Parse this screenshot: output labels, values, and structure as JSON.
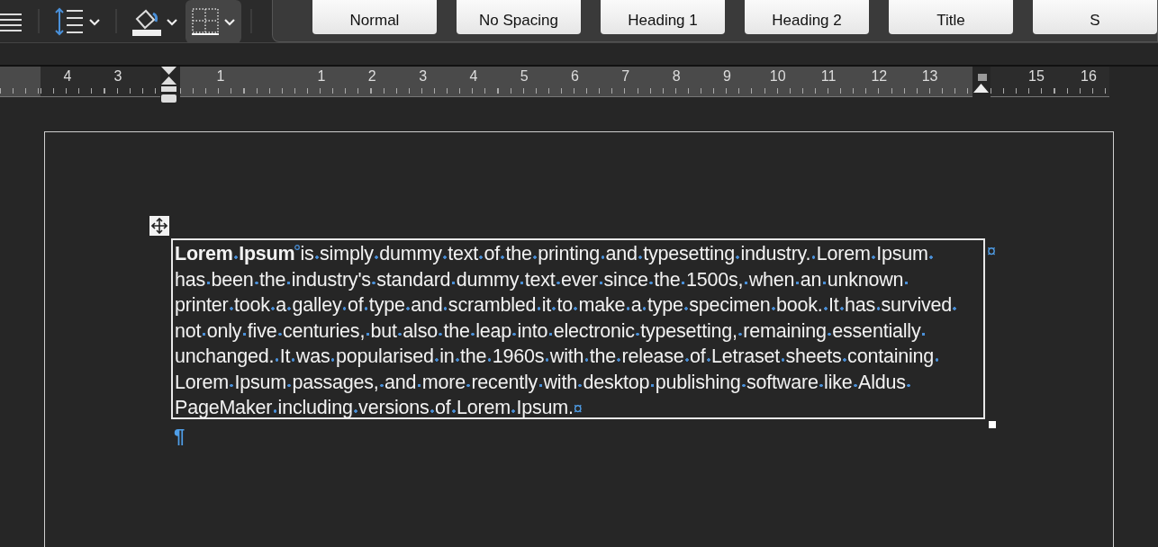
{
  "toolbar": {
    "tools": [
      {
        "kind": "align",
        "menu": false,
        "selected": false
      },
      {
        "kind": "line_spacing",
        "menu": true,
        "selected": false
      },
      {
        "kind": "shading",
        "menu": true,
        "selected": false
      },
      {
        "kind": "borders",
        "menu": true,
        "selected": true
      }
    ],
    "styles": [
      "Normal",
      "No Spacing",
      "Heading 1",
      "Heading 2",
      "Title",
      "S"
    ]
  },
  "ruler": {
    "left_labels": [
      "4",
      "3"
    ],
    "labels": [
      "1",
      "1",
      "2",
      "3",
      "4",
      "5",
      "6",
      "7",
      "8",
      "9",
      "10",
      "11",
      "12",
      "13"
    ],
    "right_labels": [
      "15",
      "16"
    ]
  },
  "document": {
    "table": {
      "cell": {
        "lead": "Lorem Ipsum",
        "lines": [
          "is simply dummy text of the printing and typesetting industry. Lorem Ipsum ",
          "has been the industry's standard dummy text ever since the 1500s, when an unknown ",
          "printer took a galley of type and scrambled it to make a type specimen book. It has survived ",
          "not only five centuries, but also the leap into electronic typesetting, remaining essentially ",
          "unchanged. It was popularised in the 1960s with the release of Letraset sheets containing ",
          "Lorem Ipsum passages, and more recently with desktop publishing software like Aldus ",
          "PageMaker including versions of Lorem Ipsum."
        ],
        "end_mark": "¤"
      },
      "row_end_mark": "¤"
    },
    "paragraph_mark": "¶"
  }
}
